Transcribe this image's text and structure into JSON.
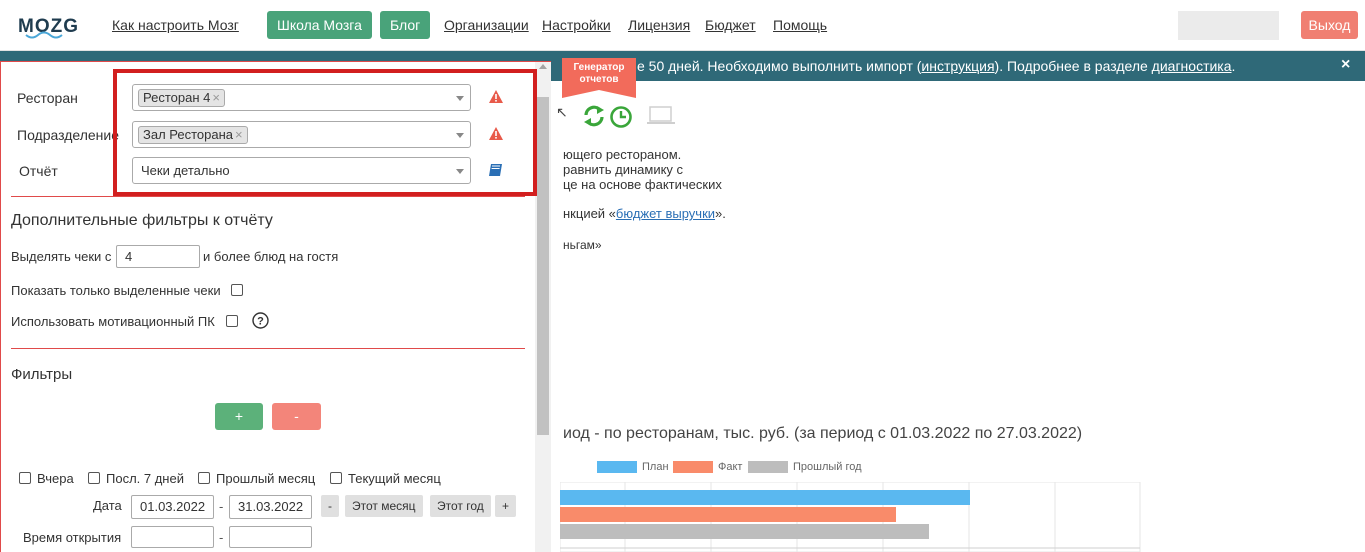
{
  "nav": {
    "logo_text": "MOZG",
    "links": [
      "Как настроить Мозг",
      "Организации",
      "Настройки",
      "Лицензия",
      "Бюджет",
      "Помощь"
    ],
    "btn_school": "Школа Мозга",
    "btn_blog": "Блог",
    "logout": "Выход"
  },
  "banner": {
    "text_part1": "е 50 дней. Необходимо выполнить импорт (",
    "link_instr": "инструкция",
    "text_part2": "). Подробнее в разделе ",
    "link_diag": "диагностика",
    "text_end": ".",
    "close": "×"
  },
  "ribbon": {
    "line1": "Генератор",
    "line2": "отчетов"
  },
  "background": {
    "line1": "ющего рестораном.",
    "line2": "равнить динамику с",
    "line3": "це на основе фактических",
    "line4_pre": "нкцией «",
    "line4_link": "бюджет выручки",
    "line4_post": "».",
    "line5": "ньгам»",
    "chart_title": "иод - по ресторанам, тыс. руб. (за период с 01.03.2022 по 27.03.2022)",
    "legend": [
      "План",
      "Факт",
      "Прошлый год"
    ]
  },
  "chart_data": {
    "type": "bar",
    "title": "иод - по ресторанам, тыс. руб. (за период с 01.03.2022 по 27.03.2022)",
    "series": [
      {
        "name": "План",
        "color": "#5ab8f0",
        "values": [
          1
        ]
      },
      {
        "name": "Факт",
        "color": "#f98b6a",
        "values": [
          0.82
        ]
      },
      {
        "name": "Прошлый год",
        "color": "#bdbdbd",
        "values": [
          0.9
        ]
      }
    ]
  },
  "filters": {
    "restaurant_label": "Ресторан",
    "restaurant_tag": "Ресторан 4",
    "division_label": "Подразделение",
    "division_tag": "Зал Ресторана",
    "report_label": "Отчёт",
    "report_value": "Чеки детально",
    "tag_remove": "×"
  },
  "extra": {
    "title": "Дополнительные фильтры к отчёту",
    "highlight_pre": "Выделять чеки с",
    "highlight_value": "4",
    "highlight_post": "и более блюд на гостя",
    "only_highlighted": "Показать только выделенные чеки",
    "use_motivational": "Использовать мотивационный ПК",
    "help": "?"
  },
  "filters2": {
    "title": "Фильтры",
    "plus": "+",
    "minus": "-",
    "yesterday": "Вчера",
    "last7": "Посл. 7 дней",
    "last_month": "Прошлый месяц",
    "this_month": "Текущий месяц",
    "date_label": "Дата",
    "date_from": "01.03.2022",
    "date_to": "31.03.2022",
    "dash": "-",
    "btn_minus": "-",
    "btn_this_month": "Этот месяц",
    "btn_this_year": "Этот год",
    "btn_plus": "+",
    "open_time_label": "Время открытия"
  }
}
